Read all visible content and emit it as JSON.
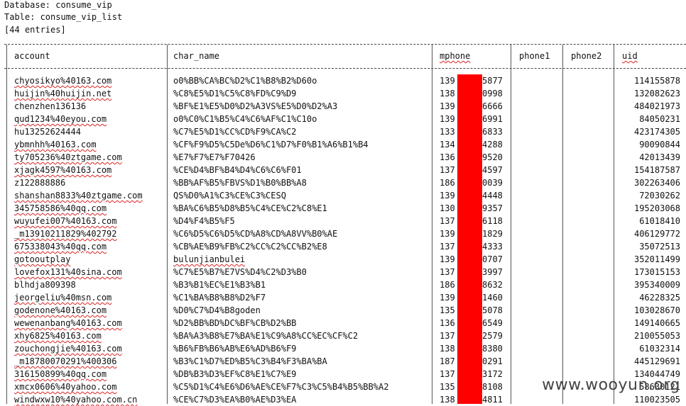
{
  "header": {
    "database_line": "Database: consume_vip",
    "table_line": "Table: consume_vip_list",
    "entries_line": "[44 entries]"
  },
  "columns": [
    "account",
    "char_name",
    "mphone",
    "phone1",
    "phone2",
    "uid"
  ],
  "rows": [
    {
      "account": "chyosikyo%40163.com",
      "char_name": "o0%BB%CA%BC%D2%C1%B8%B2%D60o",
      "mphone": "139",
      "mtail": "5877",
      "uid": "114155878"
    },
    {
      "account": "huijin%40huijin.net",
      "char_name": "%C8%E5%D1%C5%C8%FD%C9%D9",
      "mphone": "138",
      "mtail": "0998",
      "uid": "132082623"
    },
    {
      "account": "chenzhen136136",
      "char_name": "%BF%E1%E5%D0%D2%A3VS%E5%D0%D2%A3",
      "mphone": "139",
      "mtail": "6666",
      "uid": "484021973"
    },
    {
      "account": "qud1234%40eyou.com",
      "char_name": "o0%C0%C1%B5%C4%C6%AF%C1%C10o",
      "mphone": "139",
      "mtail": "6991",
      "uid": "84050231"
    },
    {
      "account": "hu13252624444",
      "char_name": "%C7%E5%D1%CC%CD%F9%CA%C2",
      "mphone": "133",
      "mtail": "6833",
      "uid": "423174305"
    },
    {
      "account": "ybmnhh%40163.com",
      "char_name": "%CF%F9%D5%C5De%D6%C1%D7%F0%B1%A6%B1%B4",
      "mphone": "134",
      "mtail": "4288",
      "uid": "90090844"
    },
    {
      "account": "ty705236%40ztgame.com",
      "char_name": "%E7%F7%E7%F70426",
      "mphone": "136",
      "mtail": "9520",
      "uid": "42013439"
    },
    {
      "account": "xjagk4597%40163.com",
      "char_name": "%CE%D4%BF%B4%D4%C6%C6%F01",
      "mphone": "137",
      "mtail": "4597",
      "uid": "154187587"
    },
    {
      "account": "z122888886",
      "char_name": "%BB%AF%B5%FBVS%D1%B0%BB%A8",
      "mphone": "186",
      "mtail": "0039",
      "uid": "302263406"
    },
    {
      "account": "shanshan8833%40ztgame.com",
      "char_name": "QS%D0%A1%C3%CE%C3%CESQ",
      "mphone": "139",
      "mtail": "4448",
      "uid": "72030262"
    },
    {
      "account": "345758586%40qq.com",
      "char_name": "%BA%C6%B5%D8%B5%C4%CE%C2%C8%E1",
      "mphone": "130",
      "mtail": "9357",
      "uid": "195203068"
    },
    {
      "account": "wuyufei007%40163.com",
      "char_name": "%D4%F4%B5%F5",
      "mphone": "137",
      "mtail": "6118",
      "uid": "61018410"
    },
    {
      "account": "_m13910211829%402792",
      "char_name": "%C6%D5%C6%D5%CD%A8%CD%A8VV%B0%AE",
      "mphone": "139",
      "mtail": "1829",
      "uid": "406129772"
    },
    {
      "account": "675338043%40qq.com",
      "char_name": "%CB%AE%B9%FB%C2%CC%C2%CC%B2%E8",
      "mphone": "137",
      "mtail": "4333",
      "uid": "35072513"
    },
    {
      "account": "gotooutplay",
      "char_name": "bulunjianbulei",
      "mphone": "139",
      "mtail": "0707",
      "uid": "352011499"
    },
    {
      "account": "lovefox131%40sina.com",
      "char_name": "%C7%E5%B7%E7VS%D4%C2%D3%B0",
      "mphone": "137",
      "mtail": "3997",
      "uid": "173015153"
    },
    {
      "account": "blhdja809398",
      "char_name": "%B3%B1%EC%E1%B3%B1",
      "mphone": "186",
      "mtail": "8632",
      "uid": "395340009"
    },
    {
      "account": "jeorgeliu%40msn.com",
      "char_name": "%C1%BA%B8%B8%D2%F7",
      "mphone": "139",
      "mtail": "1460",
      "uid": "46228325"
    },
    {
      "account": "godenone%40163.com",
      "char_name": "%D0%C7%D4%B8goden",
      "mphone": "135",
      "mtail": "5078",
      "uid": "103028670"
    },
    {
      "account": "wewenanbang%40163.com",
      "char_name": "%D2%BB%BD%DC%BF%CB%D2%BB",
      "mphone": "136",
      "mtail": "6549",
      "uid": "149140665"
    },
    {
      "account": "xhy6825%40163.com",
      "char_name": "%BA%A3%B8%E7%BA%E1%C9%A8%CC%EC%CF%C2",
      "mphone": "137",
      "mtail": "2579",
      "uid": "210055053"
    },
    {
      "account": "zouchongjie%40163.com",
      "char_name": "%B6%FB%B6%AB%E6%AD%B6%F9",
      "mphone": "138",
      "mtail": "8380",
      "uid": "61032314"
    },
    {
      "account": "_m18780070291%400306",
      "char_name": "%B3%C1%D7%ED%B5%C3%B4%F3%BA%BA",
      "mphone": "187",
      "mtail": "0291",
      "uid": "445129691"
    },
    {
      "account": "316150899%40qq.com",
      "char_name": "%DB%B3%D3%EF%C8%E1%C7%E9",
      "mphone": "137",
      "mtail": "3172",
      "uid": "134044749"
    },
    {
      "account": "xmcx0606%40yahoo.com",
      "char_name": "%C5%D1%C4%E6%D6%AE%CE%F7%C3%C5%B4%B5%BB%A2",
      "mphone": "135",
      "mtail": "8108",
      "uid": "58630121"
    },
    {
      "account": "windwxw10%40yahoo.com.cn",
      "char_name": "%CE%C7%D3%EA%B0%AE%D3%EA",
      "mphone": "138",
      "mtail": "4811",
      "uid": "110023505"
    }
  ],
  "watermark": "www.wooyun.org"
}
